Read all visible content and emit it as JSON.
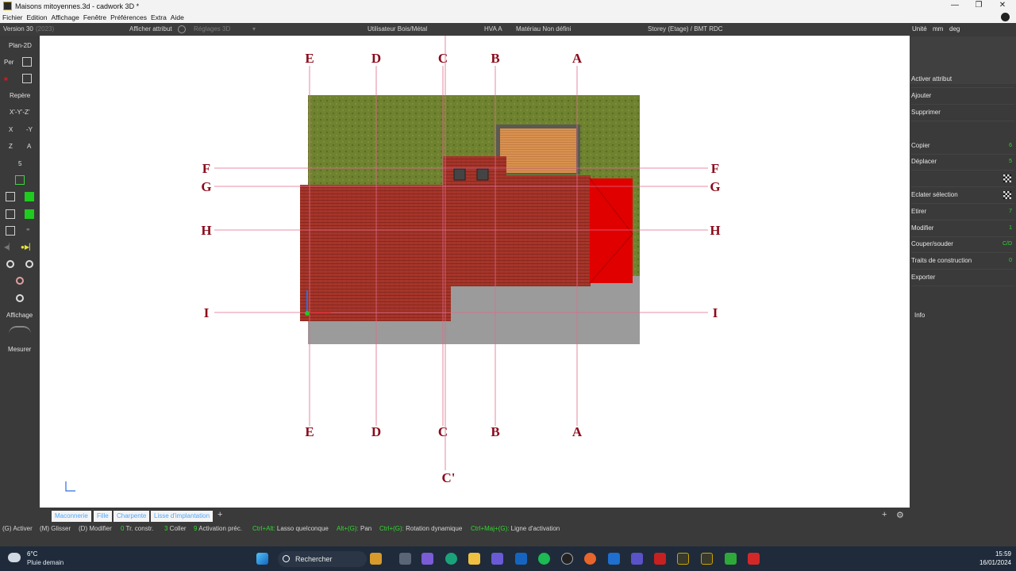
{
  "window": {
    "title": "Maisons mitoyennes.3d - cadwork 3D *",
    "minimize": "—",
    "maximize": "❐",
    "close": "✕"
  },
  "menu": [
    "Fichier",
    "Edition",
    "Affichage",
    "Fenêtre",
    "Préférences",
    "Extra",
    "Aide"
  ],
  "infobar": {
    "version": "Version 30",
    "version_year": "(2023)",
    "afficher_attribut": "Afficher attribut",
    "reglages_3d": "Réglages 3D",
    "utilisateur": "Utilisateur Bois/Métal",
    "hva": "HVA A",
    "materiau": "Matériau Non défini",
    "storey": "Storey (Etage) / BMT RDC",
    "unite": "Unité",
    "mm": "mm",
    "deg": "deg"
  },
  "left_toolbar": {
    "plan2d": "Plan-2D",
    "per": "Per",
    "repere": "Repère",
    "xyz": "X'-Y'-Z'",
    "x": "X",
    "minus_y": "-Y",
    "z": "Z",
    "a": "A",
    "five": "5",
    "affichage": "Affichage",
    "mesurer": "Mesurer"
  },
  "right_panel": {
    "commands": [
      {
        "label": "Activer attribut",
        "key": ""
      },
      {
        "label": "Ajouter",
        "key": ""
      },
      {
        "label": "Supprimer",
        "key": ""
      },
      {
        "label": "Copier",
        "key": "6"
      },
      {
        "label": "Déplacer",
        "key": "5"
      },
      {
        "label": "",
        "key": ""
      },
      {
        "label": "Eclater sélection",
        "key": ""
      },
      {
        "label": "Etirer",
        "key": "7"
      },
      {
        "label": "Modifier",
        "key": "1"
      },
      {
        "label": "Couper/souder",
        "key": "C/D"
      },
      {
        "label": "Traits de construction",
        "key": "0"
      },
      {
        "label": "Exporter",
        "key": ""
      }
    ],
    "info": "Info"
  },
  "drawing": {
    "axis_labels_vertical": [
      "E",
      "D",
      "C",
      "B",
      "A"
    ],
    "axis_labels_horizontal": [
      "F",
      "G",
      "H",
      "I"
    ],
    "extra_label": "C'",
    "colors": {
      "grass": "#6b7f2e",
      "roof_tile": "#a7352a",
      "red_element": "#e00000",
      "slab": "#9a9a9a",
      "axis_line": "#e06a8a",
      "label": "#8b0a1a",
      "timber": "#d48a4a"
    }
  },
  "tabs": [
    "Maconnerie",
    "Fille",
    "Charpente",
    "Lisse d'implantation"
  ],
  "shortcuts": [
    {
      "key": "(G)",
      "text": " Activer"
    },
    {
      "key": "(M)",
      "text": " Glisser"
    },
    {
      "key": "(D)",
      "text": " Modifier"
    },
    {
      "key": "0",
      "text": " Tr. constr."
    },
    {
      "key": "3",
      "text": " Coller"
    },
    {
      "key": "9",
      "text": " Activation préc."
    },
    {
      "key": "Ctrl+Alt:",
      "text": " Lasso quelconque"
    },
    {
      "key": "Alt+(G):",
      "text": " Pan"
    },
    {
      "key": "Ctrl+(G):",
      "text": " Rotation dynamique"
    },
    {
      "key": "Ctrl+Maj+(G):",
      "text": " Ligne d'activation"
    }
  ],
  "taskbar": {
    "temperature": "6°C",
    "weather": "Pluie demain",
    "search_placeholder": "Rechercher",
    "time": "15:59",
    "date": "16/01/2024"
  }
}
